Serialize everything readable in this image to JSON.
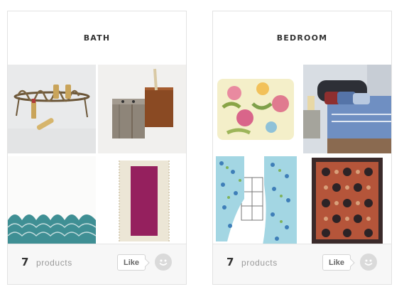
{
  "boards": [
    {
      "title": "BATH",
      "count": "7",
      "count_label": "products",
      "like_label": "Like"
    },
    {
      "title": "BEDROOM",
      "count": "7",
      "count_label": "products",
      "like_label": "Like"
    }
  ]
}
